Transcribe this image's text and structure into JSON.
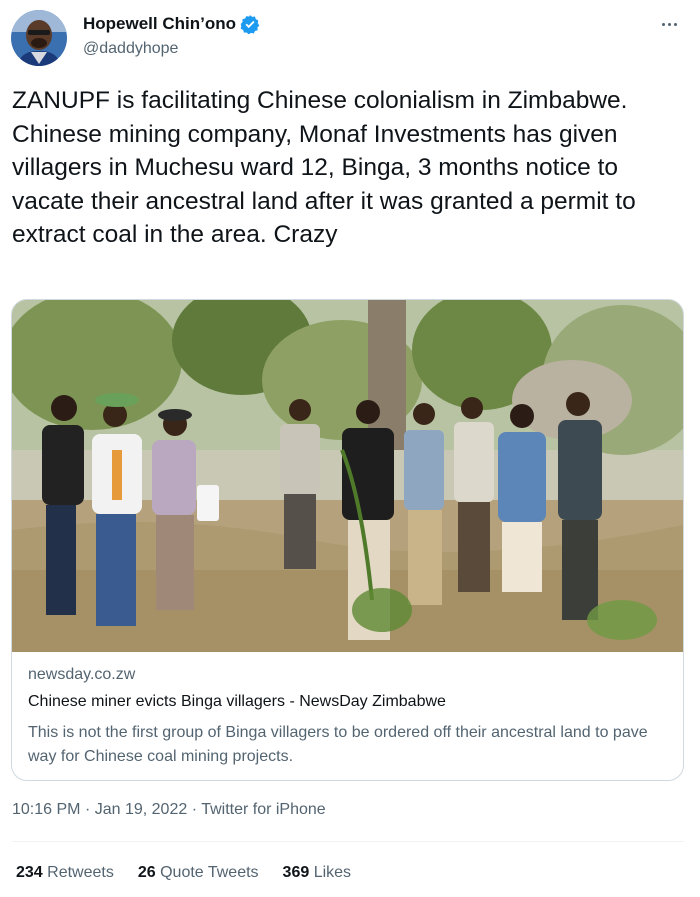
{
  "author": {
    "display_name": "Hopewell Chin’ono",
    "handle": "@daddyhope",
    "verified": true
  },
  "tweet": {
    "lines": [
      "ZANUPF is facilitating Chinese colonialism in Zimbabwe.",
      "Chinese mining company, Monaf Investments has given villagers in Muchesu ward 12, Binga, 3 months notice to vacate their ancestral land after it was granted a permit to extract coal in the area. Crazy"
    ]
  },
  "card": {
    "domain": "newsday.co.zw",
    "title": "Chinese miner evicts Binga villagers - NewsDay Zimbabwe",
    "description": "This is not the first group of Binga villagers to be ordered off their ancestral land to pave way for Chinese coal mining projects."
  },
  "meta": {
    "time": "10:16 PM",
    "separator": "·",
    "date": "Jan 19, 2022",
    "source": "Twitter for iPhone"
  },
  "stats": {
    "retweets_count": "234",
    "retweets_label": "Retweets",
    "quote_count": "26",
    "quote_label": "Quote Tweets",
    "likes_count": "369",
    "likes_label": "Likes"
  },
  "colors": {
    "text_primary": "#0f1419",
    "text_secondary": "#536471",
    "verified_blue": "#1d9bf0",
    "border": "#cfd9de"
  },
  "icons": [
    "verified-badge-icon",
    "more-options-icon"
  ]
}
